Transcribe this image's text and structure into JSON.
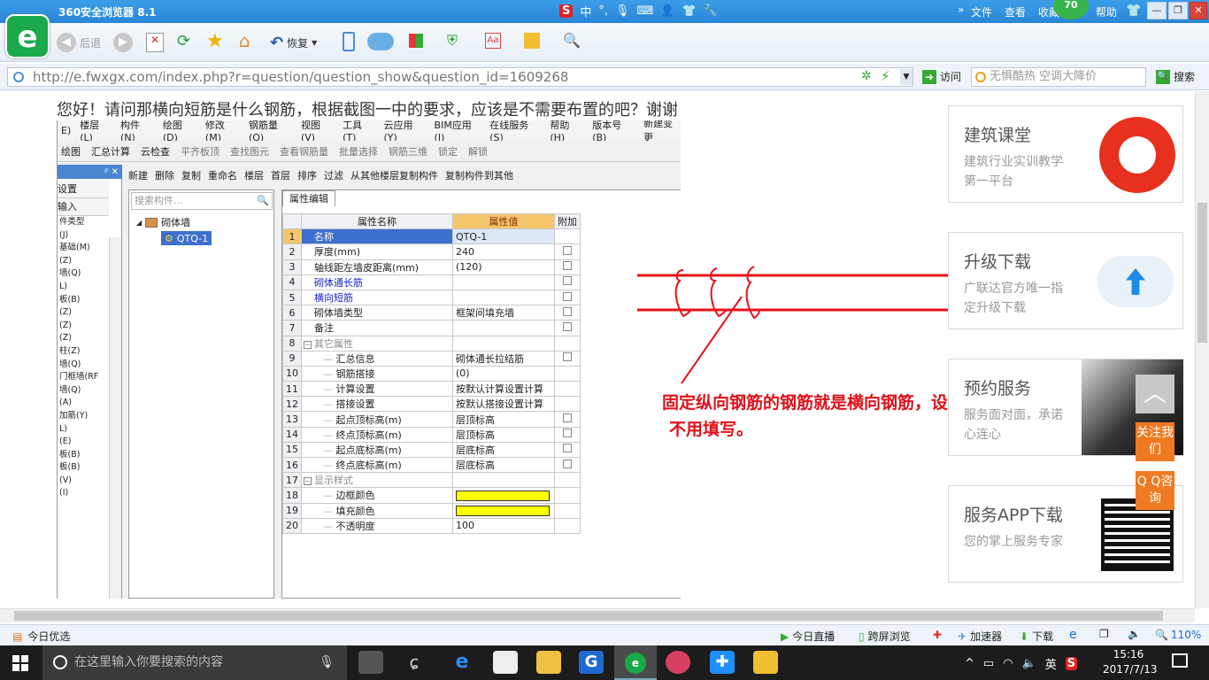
{
  "browser": {
    "title": "360安全浏览器 8.1",
    "menu": [
      "文件",
      "查看",
      "收藏",
      "帮助"
    ],
    "badge": "70",
    "back_label": "后退",
    "restore_label": "恢复",
    "url": "http://e.fwxgx.com/index.php?r=question/question_show&question_id=1609268",
    "go_label": "访问",
    "search_placeholder": "无惧酷热 空调大降价",
    "search_label": "搜索"
  },
  "question_text": "您好！请问那横向短筋是什么钢筋，根据截图一中的要求，应该是不需要布置的吧？谢谢",
  "software": {
    "menu": [
      "E)",
      "楼层(L)",
      "构件(N)",
      "绘图(D)",
      "修改(M)",
      "钢筋量(Q)",
      "视图(V)",
      "工具(T)",
      "云应用(Y)",
      "BIM应用(I)",
      "在线服务(S)",
      "帮助(H)",
      "版本号(B)",
      "新建变更"
    ],
    "toolbar": [
      "绘图",
      "汇总计算",
      "云检查",
      "平齐板顶",
      "查找图元",
      "查看钢筋量",
      "批量选择",
      "钢筋三维",
      "锁定",
      "解锁"
    ],
    "toolbar2": [
      "新建",
      "删除",
      "复制",
      "重命名",
      "楼层",
      "首层",
      "排序",
      "过滤",
      "从其他楼层复制构件",
      "复制构件到其他"
    ],
    "left_items": [
      "设置",
      "输入",
      "件类型",
      "(J)",
      "基础(M)",
      "(Z)",
      "墙(Q)",
      "L)",
      "板(B)",
      "(Z)",
      "(Z)",
      "(Z)",
      "柱(Z)",
      "墙(Q)",
      "门框墙(RF",
      "墙(Q)",
      "(A)",
      "加筋(Y)",
      "L)",
      "(E)",
      "板(B)",
      "板(B)",
      "(V)",
      "(I)"
    ],
    "search_placeholder": "搜索构件...",
    "tree_root": "砌体墙",
    "tree_child": "QTQ-1",
    "tab": "属性编辑",
    "headers": [
      "属性名称",
      "属性值",
      "附加"
    ],
    "rows": [
      {
        "n": "1",
        "name": "名称",
        "val": "QTQ-1",
        "cls": "",
        "chk": false,
        "indent": 1,
        "sel": true
      },
      {
        "n": "2",
        "name": "厚度(mm)",
        "val": "240",
        "cls": "",
        "chk": true,
        "indent": 1
      },
      {
        "n": "3",
        "name": "轴线距左墙皮距离(mm)",
        "val": "(120)",
        "cls": "",
        "chk": true,
        "indent": 1
      },
      {
        "n": "4",
        "name": "砌体通长筋",
        "val": "",
        "cls": "blue",
        "chk": true,
        "indent": 1
      },
      {
        "n": "5",
        "name": "横向短筋",
        "val": "",
        "cls": "blue",
        "chk": true,
        "indent": 1
      },
      {
        "n": "6",
        "name": "砌体墙类型",
        "val": "框架间填充墙",
        "cls": "",
        "chk": true,
        "indent": 1
      },
      {
        "n": "7",
        "name": "备注",
        "val": "",
        "cls": "",
        "chk": true,
        "indent": 1
      },
      {
        "n": "8",
        "name": "其它属性",
        "val": "",
        "cls": "grp",
        "chk": false,
        "indent": 0,
        "group": true
      },
      {
        "n": "9",
        "name": "汇总信息",
        "val": "砌体通长拉结筋",
        "cls": "",
        "chk": true,
        "indent": 2
      },
      {
        "n": "10",
        "name": "钢筋搭接",
        "val": "(0)",
        "cls": "",
        "chk": false,
        "indent": 2
      },
      {
        "n": "11",
        "name": "计算设置",
        "val": "按默认计算设置计算",
        "cls": "",
        "chk": false,
        "indent": 2
      },
      {
        "n": "12",
        "name": "搭接设置",
        "val": "按默认搭接设置计算",
        "cls": "",
        "chk": false,
        "indent": 2
      },
      {
        "n": "13",
        "name": "起点顶标高(m)",
        "val": "层顶标高",
        "cls": "",
        "chk": true,
        "indent": 2
      },
      {
        "n": "14",
        "name": "终点顶标高(m)",
        "val": "层顶标高",
        "cls": "",
        "chk": true,
        "indent": 2
      },
      {
        "n": "15",
        "name": "起点底标高(m)",
        "val": "层底标高",
        "cls": "",
        "chk": true,
        "indent": 2
      },
      {
        "n": "16",
        "name": "终点底标高(m)",
        "val": "层底标高",
        "cls": "",
        "chk": true,
        "indent": 2
      },
      {
        "n": "17",
        "name": "显示样式",
        "val": "",
        "cls": "grp",
        "chk": false,
        "indent": 0,
        "group": true
      },
      {
        "n": "18",
        "name": "边框颜色",
        "val": "",
        "cls": "",
        "chk": false,
        "indent": 2,
        "color": true
      },
      {
        "n": "19",
        "name": "填充颜色",
        "val": "",
        "cls": "",
        "chk": false,
        "indent": 2,
        "color": true
      },
      {
        "n": "20",
        "name": "不透明度",
        "val": "100",
        "cls": "",
        "chk": false,
        "indent": 2
      }
    ]
  },
  "annotation": {
    "line1": "固定纵向钢筋的钢筋就是横向钢筋，设计没有注明",
    "line2": "不用填写。"
  },
  "ads": [
    {
      "title": "建筑课堂",
      "sub": "建筑行业实训教学第一平台"
    },
    {
      "title": "升级下载",
      "sub": "广联达官方唯一指定升级下载"
    },
    {
      "title": "预约服务",
      "sub": "服务面对面，承诺心连心"
    },
    {
      "title": "服务APP下载",
      "sub": "您的掌上服务专家"
    }
  ],
  "side_buttons": {
    "follow": "关注我们",
    "qq": "Q Q咨询"
  },
  "statusbar": {
    "left": "今日优选",
    "live": "今日直播",
    "cross": "跨屏浏览",
    "speed": "加速器",
    "download": "下载",
    "zoom": "110%"
  },
  "taskbar": {
    "search_placeholder": "在这里输入你要搜索的内容",
    "ime": "英",
    "time": "15:16",
    "date": "2017/7/13"
  }
}
